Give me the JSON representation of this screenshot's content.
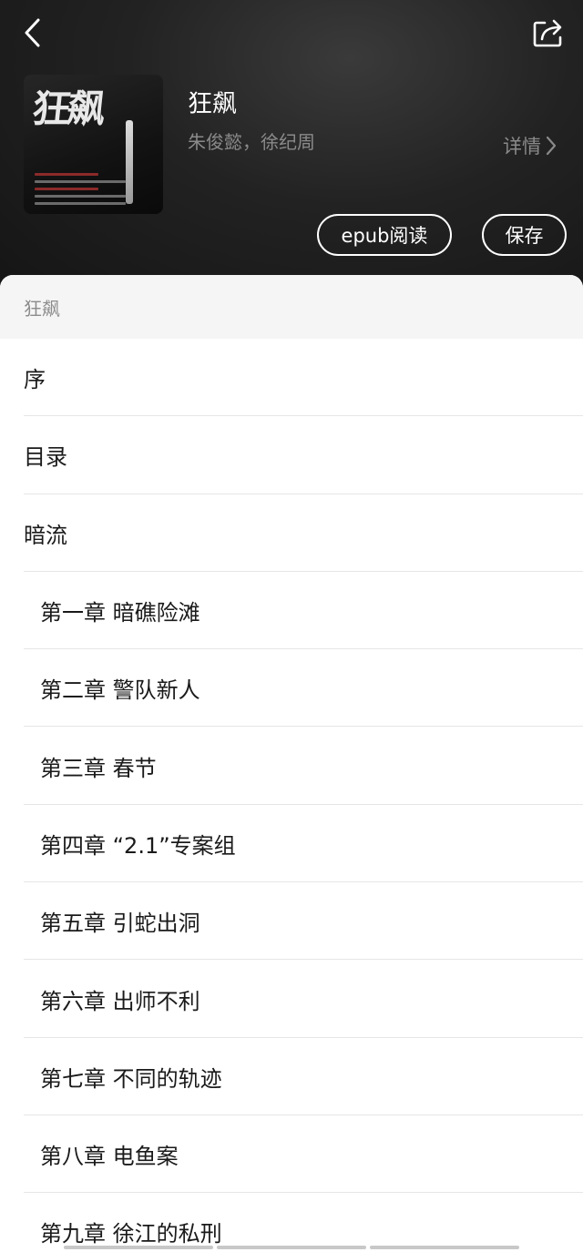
{
  "header": {
    "back_icon": "chevron-left-icon",
    "share_icon": "share-icon"
  },
  "book": {
    "cover_text": "狂飙",
    "title": "狂飙",
    "authors": "朱俊懿，徐纪周",
    "details_label": "详情",
    "details_icon": "chevron-right-icon"
  },
  "actions": {
    "epub_label": "epub阅读",
    "save_label": "保存"
  },
  "toc": {
    "heading": "狂飙",
    "items": [
      {
        "label": "序",
        "level": 0
      },
      {
        "label": "目录",
        "level": 0
      },
      {
        "label": "暗流",
        "level": 0
      },
      {
        "label": "第一章 暗礁险滩",
        "level": 1
      },
      {
        "label": "第二章 警队新人",
        "level": 1
      },
      {
        "label": "第三章 春节",
        "level": 1
      },
      {
        "label": "第四章 “2.1”专案组",
        "level": 1
      },
      {
        "label": "第五章 引蛇出洞",
        "level": 1
      },
      {
        "label": "第六章 出师不利",
        "level": 1
      },
      {
        "label": "第七章 不同的轨迹",
        "level": 1
      },
      {
        "label": "第八章 电鱼案",
        "level": 1
      },
      {
        "label": "第九章 徐江的私刑",
        "level": 1
      }
    ]
  },
  "colors": {
    "header_bg": "#1c1c1c",
    "sheet_bg": "#ffffff",
    "muted_text": "#8a8a8a"
  }
}
